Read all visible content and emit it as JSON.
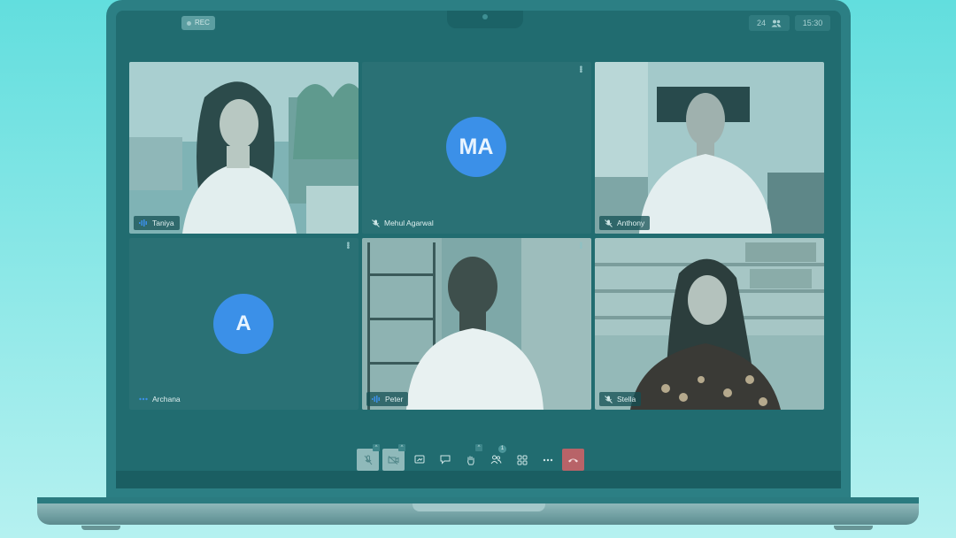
{
  "call": {
    "rec_label": "REC",
    "participant_count": "24",
    "time": "15:30"
  },
  "participants": [
    {
      "name": "Taniya",
      "status": "speaking",
      "icon": "audio-wave-icon"
    },
    {
      "name": "Mehul Agarwal",
      "initials": "MA",
      "status": "muted",
      "icon": "mic-off-icon"
    },
    {
      "name": "Anthony",
      "status": "muted",
      "icon": "mic-off-icon"
    },
    {
      "name": "Archana",
      "initials": "A",
      "status": "idle",
      "icon": "audio-dots-icon"
    },
    {
      "name": "Peter",
      "status": "speaking",
      "icon": "audio-wave-icon"
    },
    {
      "name": "Stella",
      "status": "muted",
      "icon": "mic-off-icon"
    }
  ],
  "toolbar": {
    "buttons": [
      "mic-off-icon",
      "camera-off-icon",
      "share-screen-icon",
      "chat-icon",
      "raise-hand-icon",
      "participants-icon",
      "layout-grid-icon",
      "more-icon",
      "end-call-icon"
    ],
    "participants_badge": "1"
  },
  "colors": {
    "background": "#62dede",
    "avatar": "#3b90e8",
    "end_call": "#b86368"
  }
}
